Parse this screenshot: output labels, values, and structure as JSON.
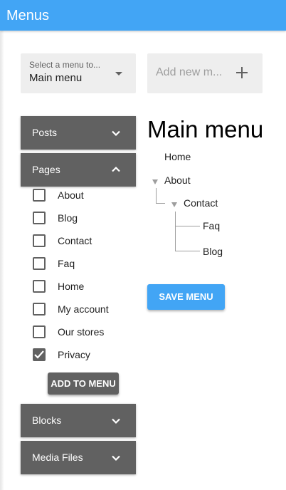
{
  "app": {
    "title": "Menus"
  },
  "menu_select": {
    "label": "Select a menu to...",
    "value": "Main menu"
  },
  "add_new": {
    "placeholder": "Add new m..."
  },
  "accordion": {
    "posts": "Posts",
    "pages": "Pages",
    "blocks": "Blocks",
    "media": "Media Files"
  },
  "pages_list": [
    {
      "label": "About",
      "checked": false
    },
    {
      "label": "Blog",
      "checked": false
    },
    {
      "label": "Contact",
      "checked": false
    },
    {
      "label": "Faq",
      "checked": false
    },
    {
      "label": "Home",
      "checked": false
    },
    {
      "label": "My account",
      "checked": false
    },
    {
      "label": "Our stores",
      "checked": false
    },
    {
      "label": "Privacy",
      "checked": true
    }
  ],
  "add_to_menu_label": "ADD TO MENU",
  "menu": {
    "title": "Main menu",
    "items": [
      "Home",
      "About",
      "Contact",
      "Faq",
      "Blog"
    ]
  },
  "save_label": "SAVE MENU",
  "colors": {
    "appbar": "#42a5f5",
    "accordion": "#616161",
    "field": "#eeeeee"
  }
}
